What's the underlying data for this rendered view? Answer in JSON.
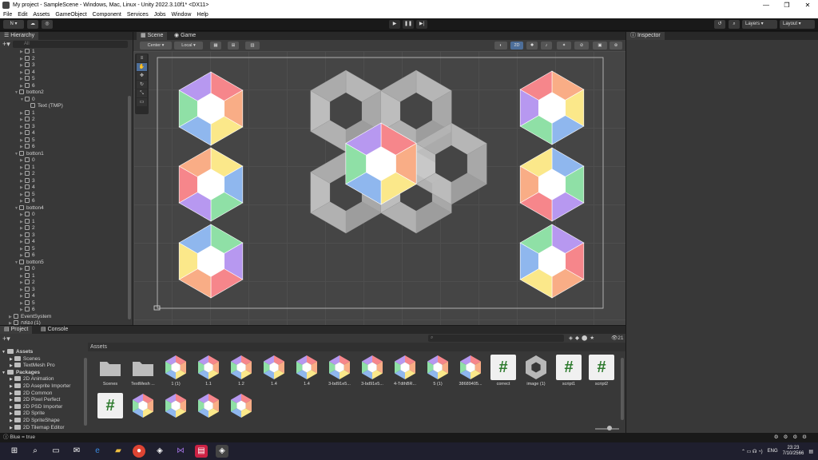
{
  "window": {
    "title": "My project - SampleScene - Windows, Mac, Linux - Unity 2022.3.10f1* <DX11>",
    "minimize": "—",
    "maximize": "❐",
    "close": "✕"
  },
  "menu": [
    "File",
    "Edit",
    "Assets",
    "GameObject",
    "Component",
    "Services",
    "Jobs",
    "Window",
    "Help"
  ],
  "toolbar": {
    "account": "N",
    "layers": "Layers",
    "layout": "Layout"
  },
  "hierarchy": {
    "tab": "Hierarchy",
    "search_placeholder": "All",
    "items": [
      {
        "label": "1",
        "indent": 3
      },
      {
        "label": "2",
        "indent": 3
      },
      {
        "label": "3",
        "indent": 3
      },
      {
        "label": "4",
        "indent": 3
      },
      {
        "label": "5",
        "indent": 3
      },
      {
        "label": "6",
        "indent": 3
      },
      {
        "label": "botton2",
        "indent": 2,
        "open": true
      },
      {
        "label": "0",
        "indent": 3,
        "open": true
      },
      {
        "label": "Text (TMP)",
        "indent": 4
      },
      {
        "label": "1",
        "indent": 3
      },
      {
        "label": "2",
        "indent": 3
      },
      {
        "label": "3",
        "indent": 3
      },
      {
        "label": "4",
        "indent": 3
      },
      {
        "label": "5",
        "indent": 3
      },
      {
        "label": "6",
        "indent": 3
      },
      {
        "label": "botton1",
        "indent": 2,
        "open": true
      },
      {
        "label": "0",
        "indent": 3
      },
      {
        "label": "1",
        "indent": 3
      },
      {
        "label": "2",
        "indent": 3
      },
      {
        "label": "3",
        "indent": 3
      },
      {
        "label": "4",
        "indent": 3
      },
      {
        "label": "5",
        "indent": 3
      },
      {
        "label": "6",
        "indent": 3
      },
      {
        "label": "botton4",
        "indent": 2,
        "open": true
      },
      {
        "label": "0",
        "indent": 3
      },
      {
        "label": "1",
        "indent": 3
      },
      {
        "label": "2",
        "indent": 3
      },
      {
        "label": "3",
        "indent": 3
      },
      {
        "label": "4",
        "indent": 3
      },
      {
        "label": "5",
        "indent": 3
      },
      {
        "label": "6",
        "indent": 3
      },
      {
        "label": "botton5",
        "indent": 2,
        "open": true
      },
      {
        "label": "0",
        "indent": 3
      },
      {
        "label": "1",
        "indent": 3
      },
      {
        "label": "2",
        "indent": 3
      },
      {
        "label": "3",
        "indent": 3
      },
      {
        "label": "4",
        "indent": 3
      },
      {
        "label": "5",
        "indent": 3
      },
      {
        "label": "6",
        "indent": 3
      },
      {
        "label": "EventSystem",
        "indent": 1
      },
      {
        "label": "กล่อง (1)",
        "indent": 1
      }
    ]
  },
  "scene": {
    "tab_scene": "Scene",
    "tab_game": "Game",
    "pivot": "Center",
    "space": "Local",
    "mode2d": "2D"
  },
  "inspector": {
    "tab": "Inspector"
  },
  "project": {
    "tab_project": "Project",
    "tab_console": "Console",
    "assets_header": "Assets",
    "count_badge": "21",
    "tree": [
      {
        "label": "Assets",
        "indent": 0,
        "bold": true
      },
      {
        "label": "Scenes",
        "indent": 2
      },
      {
        "label": "TextMesh Pro",
        "indent": 2
      },
      {
        "label": "Packages",
        "indent": 0,
        "bold": true
      },
      {
        "label": "2D Animation",
        "indent": 2
      },
      {
        "label": "2D Aseprite Importer",
        "indent": 2
      },
      {
        "label": "2D Common",
        "indent": 2
      },
      {
        "label": "2D Pixel Perfect",
        "indent": 2
      },
      {
        "label": "2D PSD Importer",
        "indent": 2
      },
      {
        "label": "2D Sprite",
        "indent": 2
      },
      {
        "label": "2D SpriteShape",
        "indent": 2
      },
      {
        "label": "2D Tilemap Editor",
        "indent": 2
      }
    ],
    "assets": [
      {
        "label": "Scenes",
        "kind": "folder"
      },
      {
        "label": "TextMesh ...",
        "kind": "folder"
      },
      {
        "label": "1 (1)",
        "kind": "hex"
      },
      {
        "label": "1.1",
        "kind": "hex"
      },
      {
        "label": "1.2",
        "kind": "hex"
      },
      {
        "label": "1.4",
        "kind": "hex"
      },
      {
        "label": "1.4",
        "kind": "hex"
      },
      {
        "label": "3-bd91e5...",
        "kind": "hex"
      },
      {
        "label": "3-bd91e5...",
        "kind": "hex"
      },
      {
        "label": "4-TdthBR...",
        "kind": "hex"
      },
      {
        "label": "5 (1)",
        "kind": "hex"
      },
      {
        "label": "38689405...",
        "kind": "hex"
      },
      {
        "label": "correct",
        "kind": "script"
      },
      {
        "label": "image (1)",
        "kind": "grayhex"
      },
      {
        "label": "script1",
        "kind": "script"
      },
      {
        "label": "script2",
        "kind": "script"
      },
      {
        "label": "",
        "kind": "script"
      },
      {
        "label": "",
        "kind": "hex"
      },
      {
        "label": "",
        "kind": "hex"
      },
      {
        "label": "",
        "kind": "hex"
      },
      {
        "label": "",
        "kind": "hex"
      }
    ]
  },
  "status": {
    "message": "Blue = true"
  },
  "taskbar": {
    "lang": "ENG",
    "time": "23:23",
    "date": "7/10/2566"
  },
  "colors": {
    "seg_red": "#f6868b",
    "seg_orange": "#f9ad86",
    "seg_yellow": "#fbe88a",
    "seg_green": "#8fe0a6",
    "seg_blue": "#8fb7ee",
    "seg_purple": "#b798f0",
    "hex_center": "#ffffff",
    "gray_hex": "#b8b8b8",
    "accent": "#4d6e99"
  }
}
